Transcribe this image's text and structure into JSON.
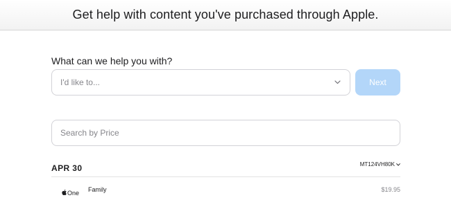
{
  "banner": {
    "title": "Get help with content you've purchased through Apple."
  },
  "help": {
    "question": "What can we help you with?",
    "select_placeholder": "I'd like to...",
    "next_label": "Next"
  },
  "search": {
    "placeholder": "Search by Price"
  },
  "purchases": [
    {
      "date": "APR 30",
      "order_id": "MT124VH80K",
      "items": [
        {
          "logo_text": "One",
          "logo_icon": "apple-logo-icon",
          "name": "Family",
          "price": "$19.95"
        }
      ]
    }
  ],
  "colors": {
    "accent_disabled": "#b3d6f9",
    "muted_text": "#86868b",
    "border": "#d2d2d7"
  }
}
